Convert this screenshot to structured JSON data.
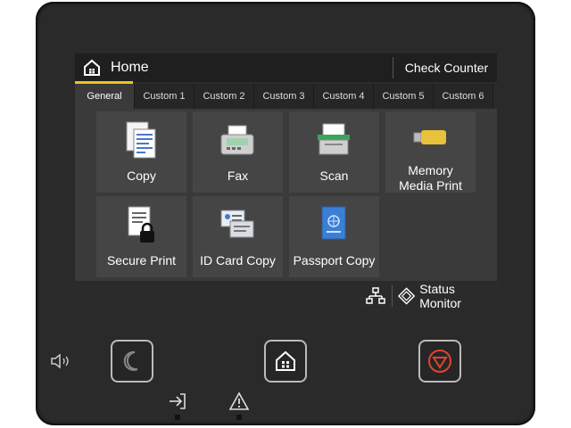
{
  "header": {
    "home_label": "Home",
    "check_counter_label": "Check Counter"
  },
  "tabs": [
    {
      "label": "General",
      "active": true
    },
    {
      "label": "Custom 1"
    },
    {
      "label": "Custom 2"
    },
    {
      "label": "Custom 3"
    },
    {
      "label": "Custom 4"
    },
    {
      "label": "Custom 5"
    },
    {
      "label": "Custom 6"
    }
  ],
  "tiles": [
    {
      "label": "Copy",
      "icon": "copy-icon"
    },
    {
      "label": "Fax",
      "icon": "fax-icon"
    },
    {
      "label": "Scan",
      "icon": "scan-icon"
    },
    {
      "label_line1": "Memory",
      "label_line2": "Media Print",
      "icon": "usb-memory-icon"
    },
    {
      "label": "Secure Print",
      "icon": "secure-print-icon"
    },
    {
      "label": "ID Card Copy",
      "icon": "id-card-icon"
    },
    {
      "label": "Passport Copy",
      "icon": "passport-icon"
    }
  ],
  "status": {
    "status_monitor_label": "Status Monitor",
    "network_icon": "network-icon"
  },
  "hardware": {
    "sleep_icon": "moon-icon",
    "home_icon": "home-icon",
    "stop_icon": "stop-icon",
    "volume_icon": "volume-icon",
    "data_icon": "data-arrow-icon",
    "error_icon": "warning-icon"
  },
  "colors": {
    "accent_underline": "#f0c419",
    "stop_red": "#e0452f",
    "usb_yellow": "#e8c23a",
    "passport_blue": "#3a7fd5",
    "scan_green": "#3aa55a"
  }
}
